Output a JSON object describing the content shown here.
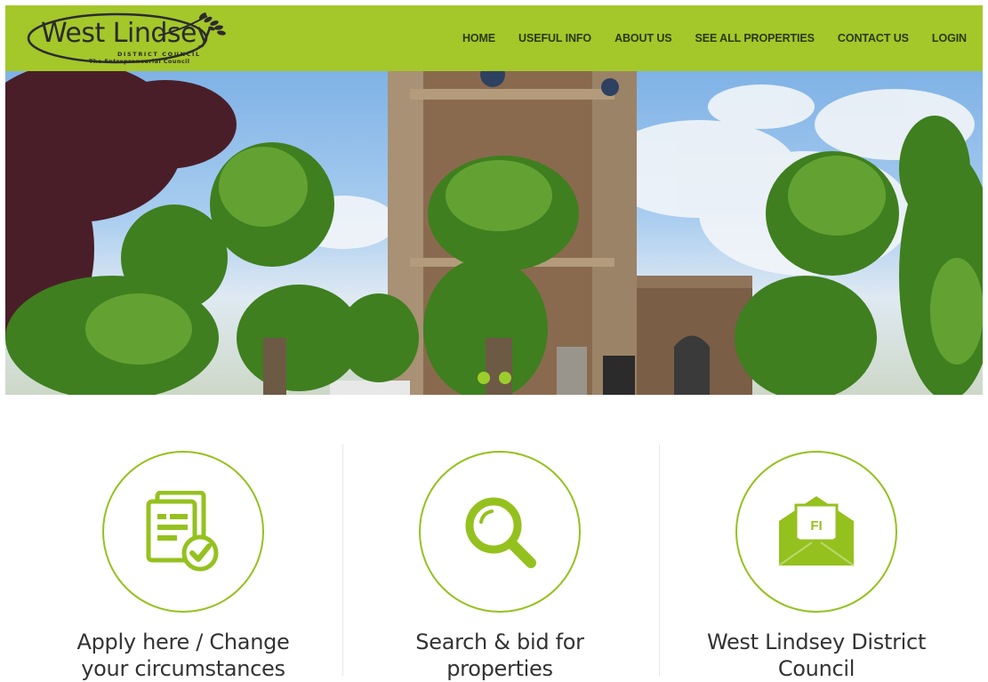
{
  "header": {
    "logo": {
      "word": "West Lindsey",
      "sub1": "DISTRICT COUNCIL",
      "sub2": "The Entrepreneurial Council"
    },
    "nav": [
      {
        "label": "HOME"
      },
      {
        "label": "USEFUL INFO"
      },
      {
        "label": "ABOUT US"
      },
      {
        "label": "SEE ALL PROPERTIES"
      },
      {
        "label": "CONTACT US"
      },
      {
        "label": "LOGIN"
      }
    ]
  },
  "hero": {
    "slide_count": 2
  },
  "features": [
    {
      "title_line1": "Apply here / Change",
      "title_line2": "your circumstances",
      "icon": "document-check-icon"
    },
    {
      "title_line1": "Search & bid for",
      "title_line2": "properties",
      "icon": "search-icon"
    },
    {
      "title_line1": "West Lindsey District",
      "title_line2": "Council",
      "icon": "envelope-icon",
      "icon_text": "FI"
    }
  ],
  "colors": {
    "brand_green": "#a4c72a",
    "accent_green": "#95c11f",
    "nav_text": "#2a3a0a"
  }
}
